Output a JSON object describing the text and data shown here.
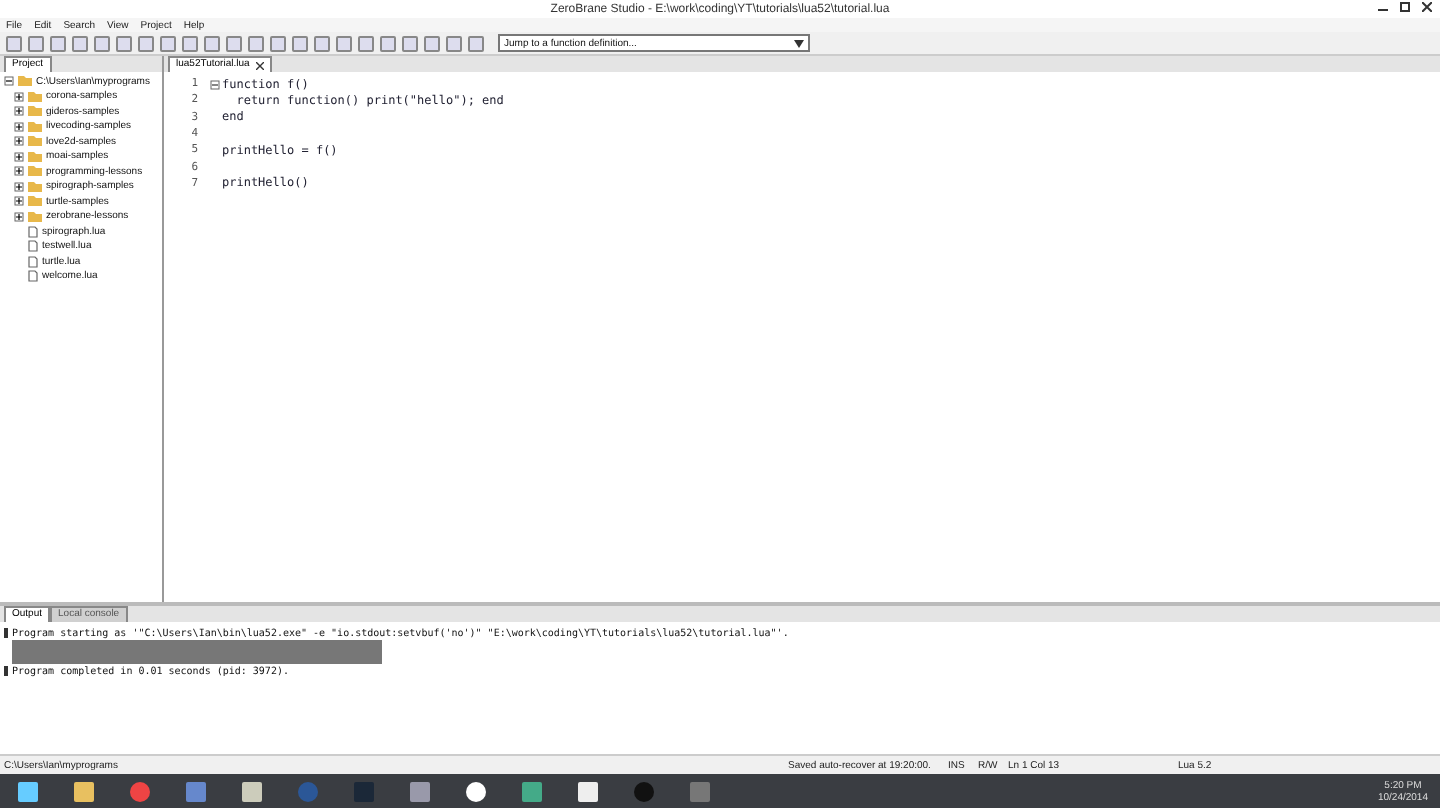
{
  "window": {
    "title": "ZeroBrane Studio - E:\\work\\coding\\YT\\tutorials\\lua52\\tutorial.lua"
  },
  "menu": [
    "File",
    "Edit",
    "Search",
    "View",
    "Project",
    "Help"
  ],
  "toolbar": {
    "function_combo": "Jump to a function definition..."
  },
  "project": {
    "tab": "Project",
    "tree": [
      {
        "label": "C:\\Users\\Ian\\myprograms",
        "kind": "folder",
        "expanded": true,
        "children": [
          {
            "label": "corona-samples",
            "kind": "folder",
            "expanded": false
          },
          {
            "label": "gideros-samples",
            "kind": "folder",
            "expanded": false
          },
          {
            "label": "livecoding-samples",
            "kind": "folder",
            "expanded": false
          },
          {
            "label": "love2d-samples",
            "kind": "folder",
            "expanded": false
          },
          {
            "label": "moai-samples",
            "kind": "folder",
            "expanded": false
          },
          {
            "label": "programming-lessons",
            "kind": "folder",
            "expanded": false
          },
          {
            "label": "spirograph-samples",
            "kind": "folder",
            "expanded": false
          },
          {
            "label": "turtle-samples",
            "kind": "folder",
            "expanded": false
          },
          {
            "label": "zerobrane-lessons",
            "kind": "folder",
            "expanded": false
          },
          {
            "label": "spirograph.lua",
            "kind": "file"
          },
          {
            "label": "testwell.lua",
            "kind": "file"
          },
          {
            "label": "turtle.lua",
            "kind": "file"
          },
          {
            "label": "welcome.lua",
            "kind": "file"
          }
        ]
      }
    ]
  },
  "editor": {
    "tabs": [
      {
        "label": "lua52Tutorial.lua",
        "selected": true
      }
    ],
    "lines": [
      {
        "number": "1",
        "code": "function f()"
      },
      {
        "number": "2",
        "code": "  return function() print(\"hello\"); end"
      },
      {
        "number": "3",
        "code": "end"
      },
      {
        "number": "4"
      },
      {
        "number": "5",
        "code": "printHello = f()"
      },
      {
        "number": "6"
      },
      {
        "number": "7",
        "code": "printHello()"
      }
    ]
  },
  "output": {
    "tabs": [
      {
        "label": "Output",
        "selected": true
      },
      {
        "label": "Local console",
        "selected": false
      }
    ],
    "lines": [
      {
        "text": "Program starting as '\"C:\\Users\\Ian\\bin\\lua52.exe\" -e \"io.stdout:setvbuf('no')\" \"E:\\work\\coding\\YT\\tutorials\\lua52\\tutorial.lua\"'.",
        "highlighted": false
      },
      {
        "text": "Program completed in 0.01 seconds (pid: 3972).",
        "highlighted": false
      }
    ]
  },
  "status_bar": {
    "path": "C:\\Users\\Ian\\myprograms",
    "message": "Saved auto-recover at 19:20:00.",
    "mode": "INS",
    "access": "R/W",
    "position": "Ln 1 Col 13",
    "language": "Lua 5.2"
  },
  "taskbar": {
    "time": "5:20 PM",
    "date": "10/24/2014"
  }
}
